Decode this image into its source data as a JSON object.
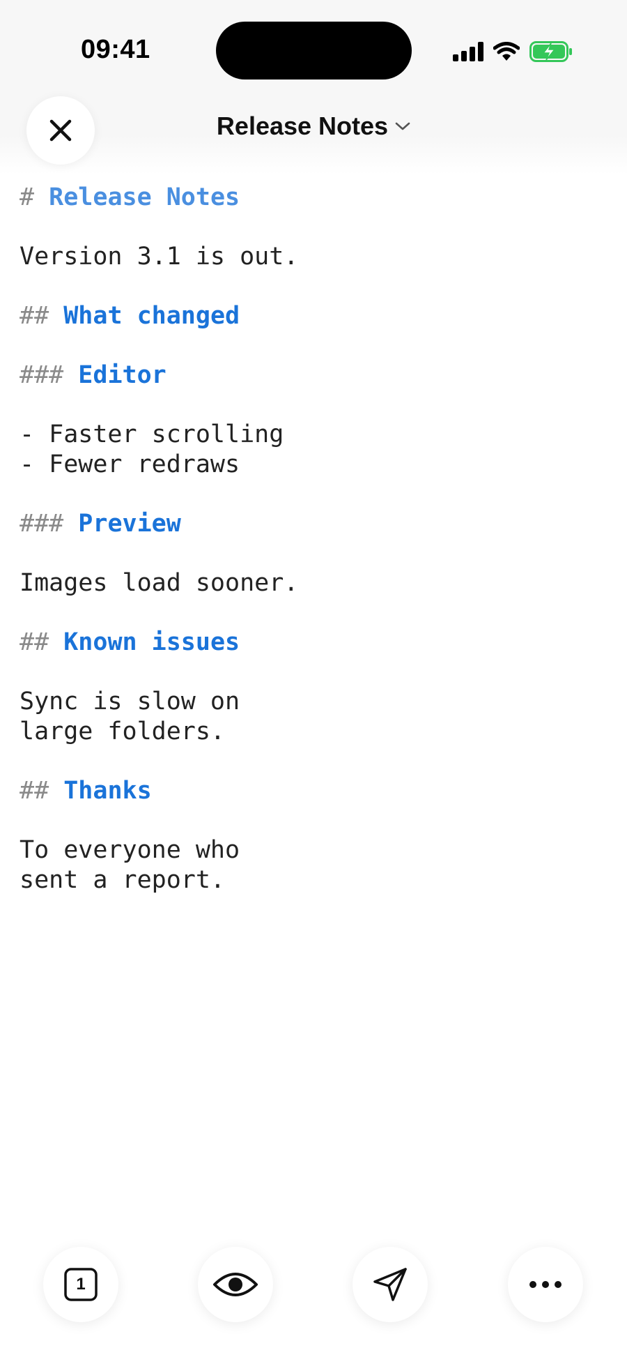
{
  "status_bar": {
    "time": "09:41",
    "icons": [
      "signal-icon",
      "wifi-icon",
      "battery-charging-icon"
    ],
    "battery_color": "#34c759"
  },
  "header": {
    "title": "Release Notes",
    "close_icon": "close-icon",
    "title_menu_icon": "chevron-down-icon"
  },
  "document": {
    "heading_color": "#1a73d9",
    "marker_color": "#8a8a8a",
    "h1_marker": "#",
    "h1_text": "Release Notes",
    "intro": "Version 3.1 is out.",
    "h2_what_changed_marker": "##",
    "h2_what_changed": "What changed",
    "h3_editor_marker": "###",
    "h3_editor": "Editor",
    "list_item_1": "- Faster scrolling",
    "list_item_2": "- Fewer redraws",
    "h3_preview_marker": "###",
    "h3_preview": "Preview",
    "preview_text": "Images load sooner.",
    "h2_known_issues_marker": "##",
    "h2_known_issues": "Known issues",
    "known_issues_line_1": "Sync is slow on",
    "known_issues_line_2": "large folders.",
    "h2_thanks_marker": "##",
    "h2_thanks": "Thanks",
    "thanks_line_1": "To everyone who",
    "thanks_line_2": "sent a report."
  },
  "toolbar": {
    "tabs_count": "1",
    "icons": [
      "tabs-icon",
      "eye-icon",
      "send-icon",
      "more-icon"
    ]
  }
}
